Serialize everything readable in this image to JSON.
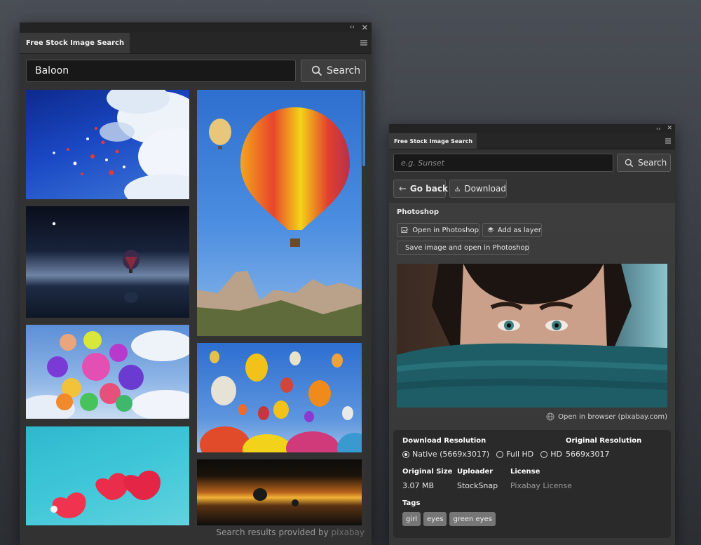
{
  "left_panel": {
    "tab_title": "Free Stock Image Search",
    "search": {
      "value": "Baloon",
      "button_label": "Search"
    },
    "results": [
      {
        "name": "Balloons in blue sky with clouds"
      },
      {
        "name": "Hot air balloon over misty sea at night"
      },
      {
        "name": "Large colorful hot air balloon above rock formations"
      },
      {
        "name": "Bunch of colorful party balloons"
      },
      {
        "name": "Many hot air balloons in the sky"
      },
      {
        "name": "Red heart balloons against turquoise sky"
      },
      {
        "name": "Balloons over golden sunset clouds"
      }
    ],
    "footer": {
      "prefix": "Search results provided by",
      "brand": "pixabay"
    }
  },
  "right_panel": {
    "tab_title": "Free Stock Image Search",
    "search": {
      "placeholder": "e.g. Sunset",
      "button_label": "Search"
    },
    "go_back_label": "Go back",
    "download_label": "Download",
    "section_title": "Photoshop",
    "open_in_photoshop": "Open in Photoshop",
    "add_as_layer": "Add as layer",
    "save_and_open": "Save image and open in Photoshop",
    "preview_name": "Woman with eyes above teal scarf",
    "open_in_browser": "Open in browser (pixabay.com)",
    "details": {
      "download_resolution_label": "Download Resolution",
      "options": [
        "Native (5669x3017)",
        "Full HD",
        "HD"
      ],
      "selected_option": 0,
      "original_resolution_label": "Original Resolution",
      "original_resolution_value": "5669x3017",
      "original_size_label": "Original Size",
      "original_size_value": "3.07 MB",
      "uploader_label": "Uploader",
      "uploader_value": "StockSnap",
      "license_label": "License",
      "license_value": "Pixabay License",
      "tags_label": "Tags",
      "tags": [
        "girl",
        "eyes",
        "green eyes"
      ]
    }
  },
  "colors": {
    "panel": "#323232",
    "dark_strip": "#232323",
    "input_bg": "#181818",
    "muted_text": "#9a9a9a",
    "scrollbar": "#3f7fbf"
  }
}
